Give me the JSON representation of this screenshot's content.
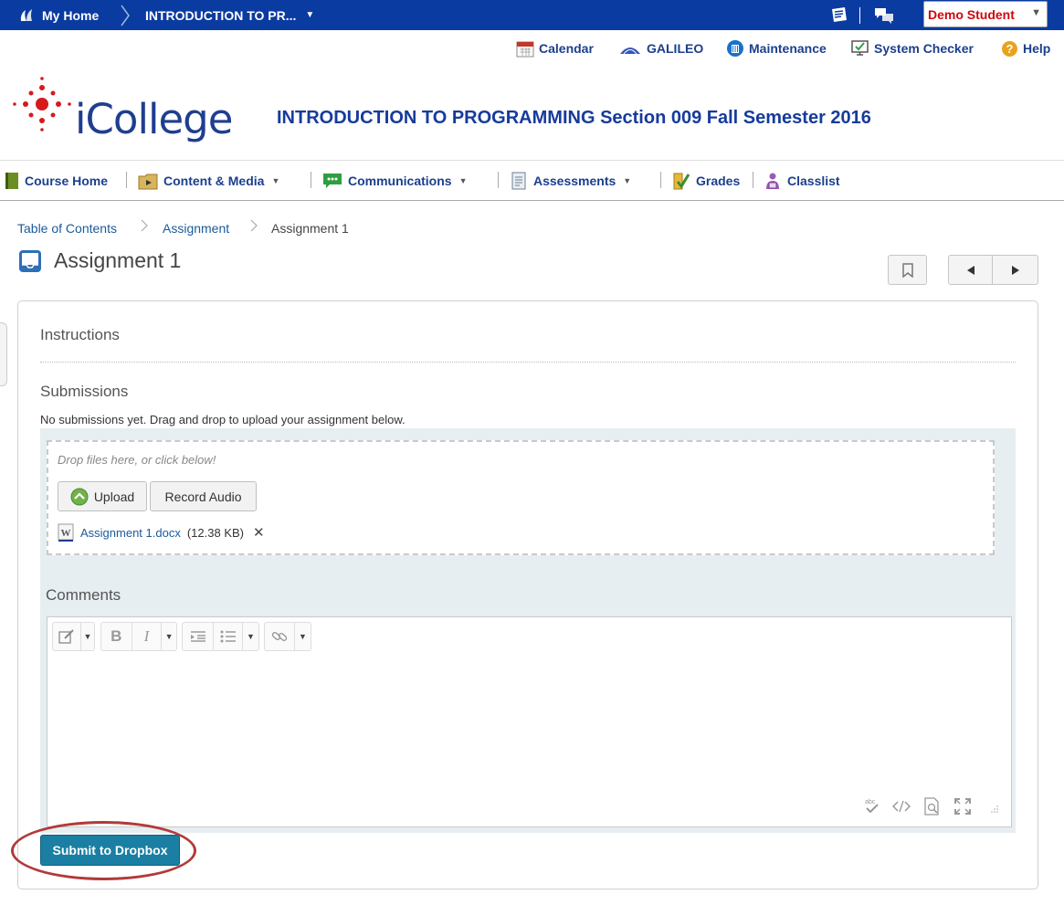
{
  "topbar": {
    "home_label": "My Home",
    "course_label": "INTRODUCTION TO PR...",
    "user_name": "Demo Student"
  },
  "utility_links": {
    "calendar": "Calendar",
    "galileo": "GALILEO",
    "maintenance": "Maintenance",
    "system_checker": "System Checker",
    "help": "Help"
  },
  "header": {
    "logo_text": "iCollege",
    "course_title": "INTRODUCTION TO PROGRAMMING Section 009 Fall Semester 2016"
  },
  "nav": {
    "course_home": "Course Home",
    "content_media": "Content & Media",
    "communications": "Communications",
    "assessments": "Assessments",
    "grades": "Grades",
    "classlist": "Classlist"
  },
  "breadcrumb": {
    "toc": "Table of Contents",
    "assignment": "Assignment",
    "current": "Assignment 1"
  },
  "page": {
    "title": "Assignment 1"
  },
  "instructions": {
    "heading": "Instructions"
  },
  "submissions": {
    "heading": "Submissions",
    "note": "No submissions yet. Drag and drop to upload your assignment below.",
    "drop_text": "Drop files here, or click below!",
    "upload_label": "Upload",
    "record_audio_label": "Record Audio",
    "file_name": "Assignment 1.docx",
    "file_size": "(12.38 KB)",
    "remove_glyph": "✕"
  },
  "comments": {
    "heading": "Comments"
  },
  "submit": {
    "label": "Submit to Dropbox"
  },
  "colors": {
    "topbar_bg": "#0a3ba0",
    "link": "#1c3f8d",
    "user_name": "#d1060c",
    "submit_bg": "#1a7fa3",
    "upload_zone_bg": "#e6eef2",
    "highlight_ring": "#b23a3a"
  }
}
